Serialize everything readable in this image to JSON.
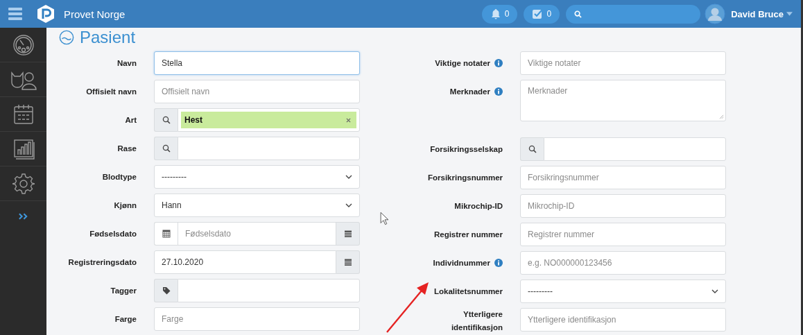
{
  "header": {
    "app_name": "Provet Norge",
    "notifications": "0",
    "tasks": "0",
    "user": "David Bruce"
  },
  "page_title": "Pasient",
  "left_fields": [
    {
      "kind": "text",
      "label": "Navn",
      "value": "Stella",
      "focused": true
    },
    {
      "kind": "text",
      "label": "Offisielt navn",
      "placeholder": "Offisielt navn",
      "focused": false
    },
    {
      "kind": "search",
      "label": "Art",
      "chip": "Hest"
    },
    {
      "kind": "search",
      "label": "Rase"
    },
    {
      "kind": "select",
      "label": "Blodtype",
      "value": "---------"
    },
    {
      "kind": "select",
      "label": "Kjønn",
      "value": "Hann"
    },
    {
      "kind": "date",
      "label": "Fødselsdato",
      "placeholder": "Fødselsdato",
      "left_addon": true
    },
    {
      "kind": "date",
      "label": "Registreringsdato",
      "value": "27.10.2020",
      "left_addon": false
    },
    {
      "kind": "tag",
      "label": "Tagger"
    },
    {
      "kind": "text",
      "label": "Farge",
      "placeholder": "Farge",
      "focused": false
    }
  ],
  "right_fields": [
    {
      "kind": "text",
      "label": "Viktige notater",
      "info": true,
      "placeholder": "Viktige notater",
      "focused": false
    },
    {
      "kind": "textarea",
      "label": "Merknader",
      "info": true,
      "placeholder": "Merknader"
    },
    {
      "kind": "search",
      "label": "Forsikringsselskap",
      "info": false
    },
    {
      "kind": "text",
      "label": "Forsikringsnummer",
      "info": false,
      "placeholder": "Forsikringsnummer",
      "focused": false
    },
    {
      "kind": "text",
      "label": "Mikrochip-ID",
      "info": false,
      "placeholder": "Mikrochip-ID",
      "focused": false
    },
    {
      "kind": "text",
      "label": "Registrer nummer",
      "info": false,
      "placeholder": "Registrer nummer",
      "focused": false
    },
    {
      "kind": "text",
      "label": "Individnummer",
      "info": true,
      "placeholder": "e.g. NO000000123456",
      "focused": false
    },
    {
      "kind": "select",
      "label": "Lokalitetsnummer",
      "info": false,
      "value": "---------"
    },
    {
      "kind": "text",
      "label": "Ytterligere identifikasjon",
      "info": false,
      "placeholder": "Ytterligere identifikasjon",
      "focused": false
    }
  ]
}
